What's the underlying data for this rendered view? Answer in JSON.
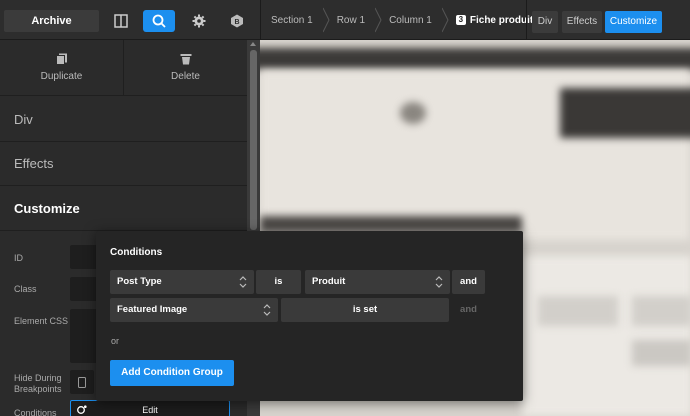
{
  "toolbar": {
    "archive_label": "Archive",
    "icons": [
      "columns-icon",
      "search-icon",
      "gear-icon",
      "plugin-icon"
    ]
  },
  "breadcrumb": {
    "items": [
      "Section 1",
      "Row 1",
      "Column 1"
    ],
    "current_number": "3",
    "current_label": "Fiche produit"
  },
  "view_tabs": {
    "div": "Div",
    "effects": "Effects",
    "customize": "Customize",
    "active": "Customize"
  },
  "actions": {
    "duplicate": "Duplicate",
    "delete": "Delete"
  },
  "sections": {
    "div": "Div",
    "effects": "Effects",
    "customize": "Customize"
  },
  "fields": {
    "id": "ID",
    "class": "Class",
    "element_css": "Element CSS",
    "hide_breakpoints_line1": "Hide During",
    "hide_breakpoints_line2": "Breakpoints",
    "conditions": "Conditions",
    "conditions_button": "Edit"
  },
  "conditions": {
    "title": "Conditions",
    "rows": [
      {
        "field": "Post Type",
        "operator": "is",
        "value": "Produit",
        "joiner": "and",
        "joiner_active": true
      },
      {
        "field": "Featured Image",
        "operator": "is set",
        "value": "",
        "joiner": "and",
        "joiner_active": false
      }
    ],
    "or_label": "or",
    "add_group_label": "Add Condition Group"
  },
  "colors": {
    "accent": "#1c8fef",
    "panel": "#2b2b2b",
    "popup": "#252525"
  }
}
